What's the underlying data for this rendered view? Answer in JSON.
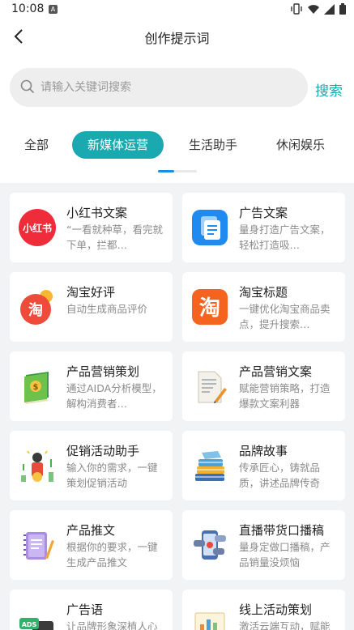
{
  "status": {
    "time": "10:08",
    "notif": "A"
  },
  "nav": {
    "title": "创作提示词"
  },
  "search": {
    "placeholder": "请输入关键词搜索",
    "button": "搜索"
  },
  "tabs": [
    {
      "label": "全部"
    },
    {
      "label": "新媒体运营"
    },
    {
      "label": "生活助手"
    },
    {
      "label": "休闲娱乐"
    }
  ],
  "colors": {
    "accent": "#1aa9b0",
    "indicator": "#1a8fe0"
  },
  "cards": [
    {
      "title": "小红书文案",
      "desc": "“一看就种草，看完就下单，拦都…",
      "icon": "xiaohongshu-icon",
      "icon_text": "小红书"
    },
    {
      "title": "广告文案",
      "desc": "量身打造广告文案，轻松打造吸…",
      "icon": "document-stack-icon"
    },
    {
      "title": "淘宝好评",
      "desc": "自动生成商品评价",
      "icon": "taobao-review-icon",
      "icon_text": "淘"
    },
    {
      "title": "淘宝标题",
      "desc": "一键优化淘宝商品卖点，提升搜索…",
      "icon": "taobao-title-icon",
      "icon_text": "淘"
    },
    {
      "title": "产品营销策划",
      "desc": "通过AIDA分析模型，解构消费者…",
      "icon": "money-book-icon"
    },
    {
      "title": "产品营销文案",
      "desc": "赋能营销策略，打造爆款文案利器",
      "icon": "pen-paper-icon"
    },
    {
      "title": "促销活动助手",
      "desc": "输入你的需求，一键策划促销活动",
      "icon": "promotion-icon"
    },
    {
      "title": "品牌故事",
      "desc": "传承匠心，铸就品质，讲述品牌传奇",
      "icon": "book-stack-icon"
    },
    {
      "title": "产品推文",
      "desc": "根据你的要求，一键生成产品推文",
      "icon": "notebook-pen-icon"
    },
    {
      "title": "直播带货口播稿",
      "desc": "量身定做口播稿，产品销量没烦恼",
      "icon": "live-phone-icon"
    },
    {
      "title": "广告语",
      "desc": "让品牌形象深植人心",
      "icon": "ads-icon",
      "icon_text": "ADS"
    },
    {
      "title": "线上活动策划",
      "desc": "激活云端互动，赋能品牌增长",
      "icon": "chart-board-icon"
    }
  ]
}
